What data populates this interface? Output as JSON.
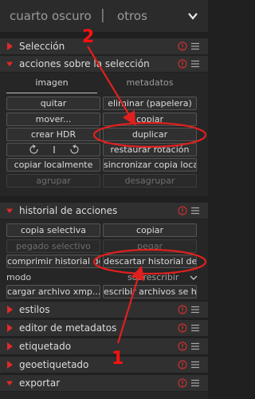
{
  "topbar": {
    "title": "cuarto oscuro",
    "separator": "|",
    "subtitle": "otros"
  },
  "sections": {
    "seleccion": "Selección",
    "acciones": "acciones sobre la selección",
    "historial": "historial de acciones",
    "estilos": "estilos",
    "editor": "editor de metadatos",
    "etiquetado": "etiquetado",
    "geoetiquetado": "geoetiquetado",
    "exportar": "exportar"
  },
  "tabs": {
    "imagen": "imagen",
    "metadatos": "metadatos"
  },
  "buttons": {
    "quitar": "quitar",
    "eliminar": "eliminar (papelera)",
    "mover": "mover...",
    "copiar1": "copiar",
    "crear_hdr": "crear HDR",
    "duplicar": "duplicar",
    "restaurar": "restaurar rotación",
    "copiar_local": "copiar localmente",
    "sincronizar": "sincronizar copia local",
    "agrupar": "agrupar",
    "desagrupar": "desagrupar",
    "copia_selectiva": "copia selectiva",
    "copiar2": "copiar",
    "pegado_selectivo": "pegado selectivo",
    "pegar": "pegar",
    "comprimir": "comprimir historial de ...",
    "descartar": "descartar historial de ...",
    "cargar": "cargar archivo xmp...",
    "escribir": "escribir archivos se h..."
  },
  "mode": {
    "label": "modo",
    "value": "sobrescribir"
  },
  "annotations": {
    "num1": "1",
    "num2": "2",
    "color": "#ff1010"
  },
  "colors": {
    "arrow": "#e0201f",
    "background": "#202020",
    "header": "#303030"
  }
}
